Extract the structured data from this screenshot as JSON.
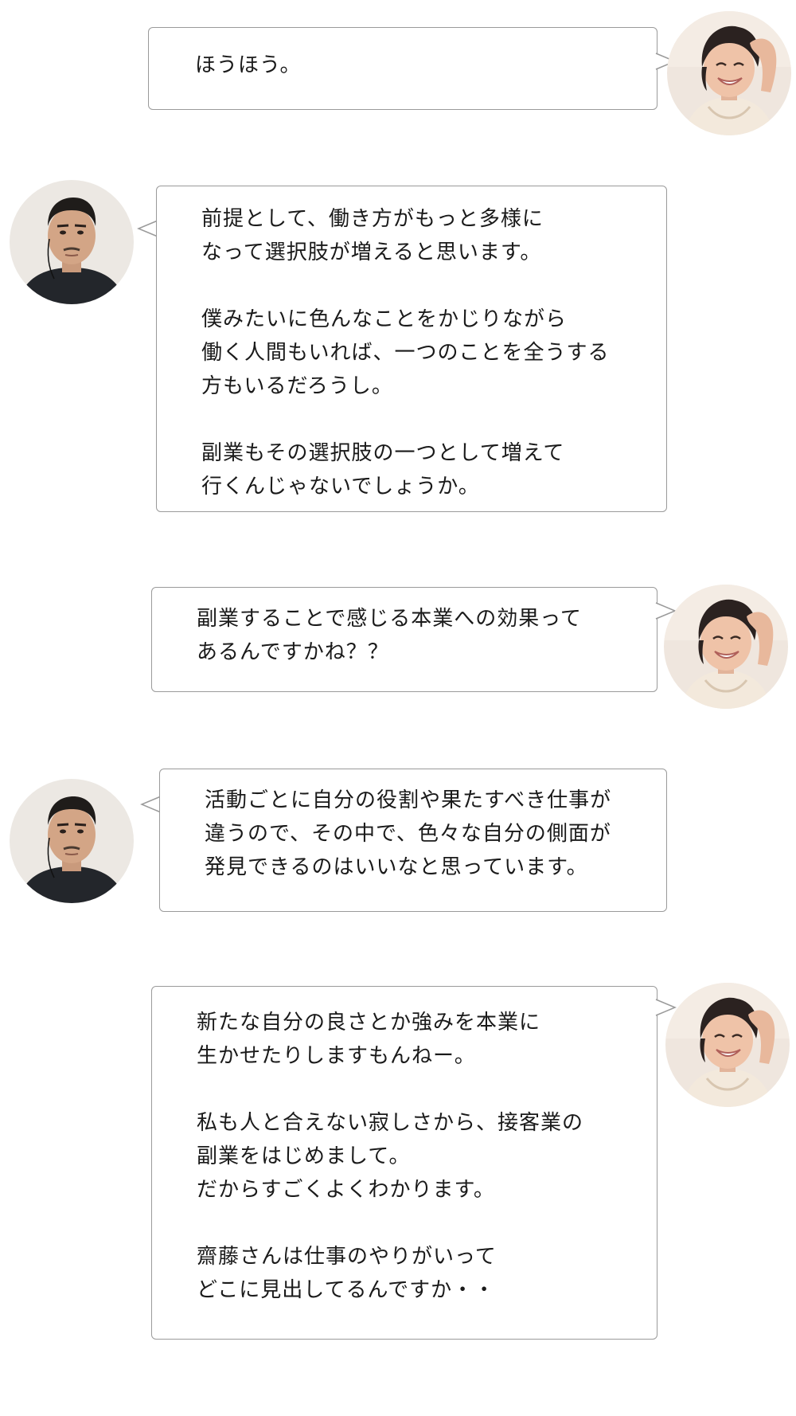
{
  "messages": [
    {
      "speaker": "interviewer",
      "text": "ほうほう。"
    },
    {
      "speaker": "guest",
      "text": "前提として、働き方がもっと多様に\nなって選択肢が増えると思います。\n\n僕みたいに色んなことをかじりながら\n働く人間もいれば、一つのことを全うする\n方もいるだろうし。\n\n副業もその選択肢の一つとして増えて\n行くんじゃないでしょうか。"
    },
    {
      "speaker": "interviewer",
      "text": "副業することで感じる本業への効果って\nあるんですかね？？"
    },
    {
      "speaker": "guest",
      "text": "活動ごとに自分の役割や果たすべき仕事が\n違うので、その中で、色々な自分の側面が\n発見できるのはいいなと思っています。"
    },
    {
      "speaker": "interviewer",
      "text": "新たな自分の良さとか強みを本業に\n生かせたりしますもんねー。\n\n私も人と合えない寂しさから、接客業の\n副業をはじめまして。\nだからすごくよくわかります。\n\n齋藤さんは仕事のやりがいって\nどこに見出してるんですか・・"
    }
  ],
  "colors": {
    "bubble_border": "#9a9a9a",
    "text": "#1a1a1a",
    "background": "#ffffff"
  },
  "icons": {
    "interviewer_avatar": "interviewer-avatar-photo",
    "guest_avatar": "guest-avatar-photo"
  }
}
